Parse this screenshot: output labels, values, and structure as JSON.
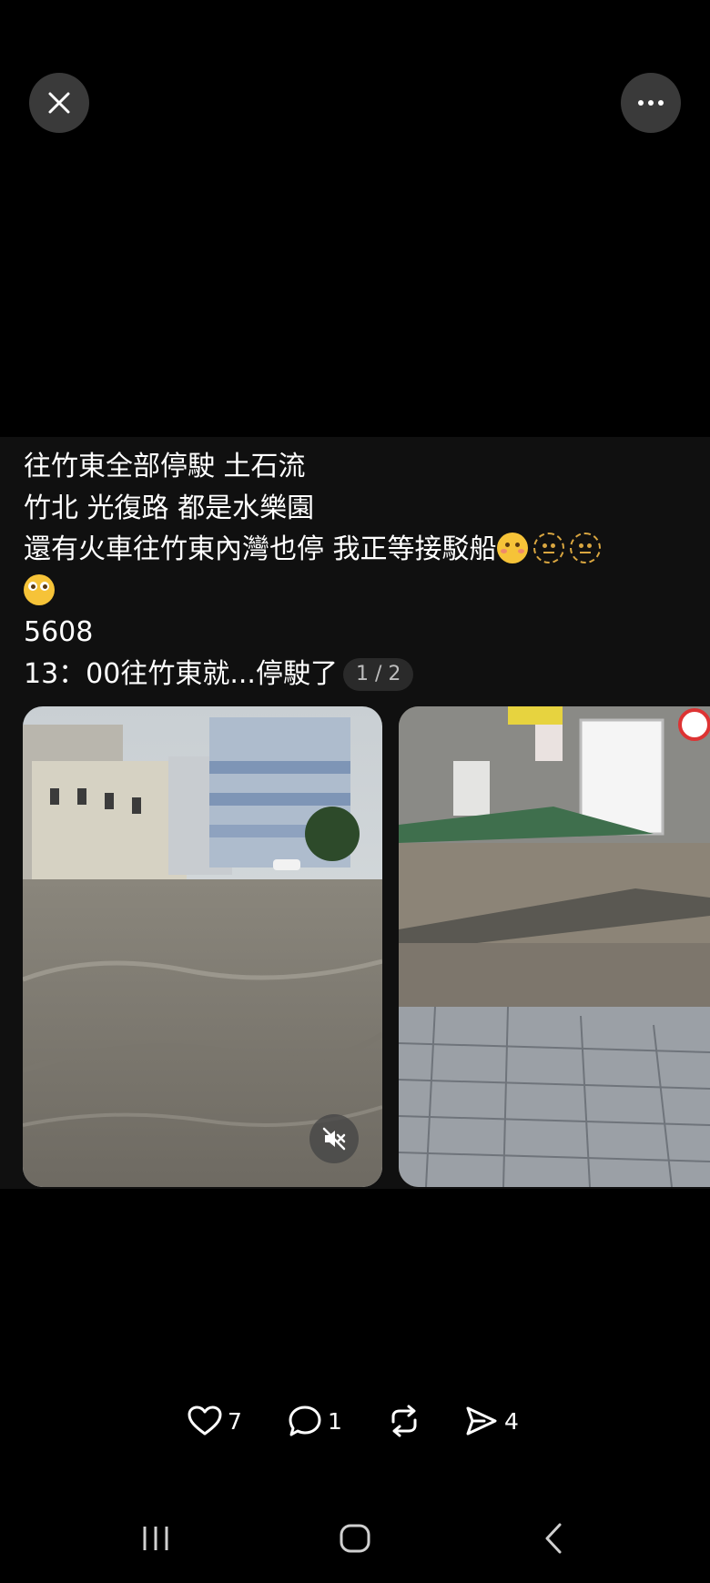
{
  "header": {
    "close_icon": "close-icon",
    "more_icon": "more-horizontal-icon"
  },
  "post": {
    "lines": [
      "往竹東全部停駛 土石流",
      "竹北 光復路 都是水樂園",
      "還有火車往竹東內灣也停 我正等接駁船",
      "",
      "5608",
      "13：00往竹東就...停駛了"
    ],
    "emojis_line3": [
      "woozy-face-emoji",
      "dotted-face-emoji",
      "dotted-face-emoji"
    ],
    "emoji_line4": "flushed-face-emoji",
    "page_indicator": "1 / 2",
    "media": [
      {
        "kind": "video",
        "description_icon": "flooded-street-video",
        "muted_icon": "muted-speaker-icon"
      },
      {
        "kind": "image",
        "description_icon": "flooded-sidewalk-photo"
      }
    ]
  },
  "actions": {
    "like_count": "7",
    "comment_count": "1",
    "share_count": "4",
    "like_icon": "heart-icon",
    "comment_icon": "comment-icon",
    "repost_icon": "repost-icon",
    "share_icon": "send-icon"
  },
  "navbar": {
    "recents_icon": "recent-apps-icon",
    "home_icon": "home-icon",
    "back_icon": "back-icon"
  }
}
